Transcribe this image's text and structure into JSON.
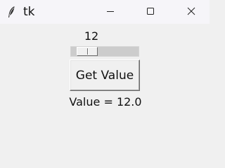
{
  "window": {
    "title": "tk",
    "icons": {
      "app": "feather-icon",
      "minimize": "minimize-icon",
      "maximize": "maximize-icon",
      "close": "close-icon"
    }
  },
  "scale": {
    "value_label": "12",
    "value": 12,
    "min": 0,
    "max": 100
  },
  "button": {
    "label": "Get Value"
  },
  "result": {
    "text": "Value = 12.0"
  }
}
